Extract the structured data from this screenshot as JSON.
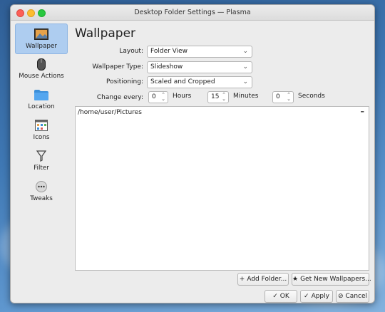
{
  "window": {
    "title": "Desktop Folder Settings — Plasma"
  },
  "sidebar": {
    "items": [
      {
        "label": "Wallpaper",
        "icon": "wallpaper-icon",
        "active": true
      },
      {
        "label": "Mouse Actions",
        "icon": "mouse-icon",
        "active": false
      },
      {
        "label": "Location",
        "icon": "folder-icon",
        "active": false
      },
      {
        "label": "Icons",
        "icon": "icons-grid-icon",
        "active": false
      },
      {
        "label": "Filter",
        "icon": "filter-icon",
        "active": false
      },
      {
        "label": "Tweaks",
        "icon": "tweaks-icon",
        "active": false
      }
    ]
  },
  "main": {
    "title": "Wallpaper",
    "layout": {
      "label": "Layout:",
      "value": "Folder View"
    },
    "wallpaper_type": {
      "label": "Wallpaper Type:",
      "value": "Slideshow"
    },
    "positioning": {
      "label": "Positioning:",
      "value": "Scaled and Cropped"
    },
    "change_every": {
      "label": "Change every:",
      "hours_value": "0",
      "hours_unit": "Hours",
      "minutes_value": "15",
      "minutes_unit": "Minutes",
      "seconds_value": "0",
      "seconds_unit": "Seconds"
    },
    "folders": [
      "/home/user/Pictures"
    ],
    "remove_symbol": "–"
  },
  "buttons": {
    "add_folder": "Add Folder...",
    "get_new": "Get New Wallpapers...",
    "ok": "OK",
    "apply": "Apply",
    "cancel": "Cancel"
  },
  "colors": {
    "active_item": "#aecdf0",
    "desktop_bg": "#3f78b4"
  }
}
